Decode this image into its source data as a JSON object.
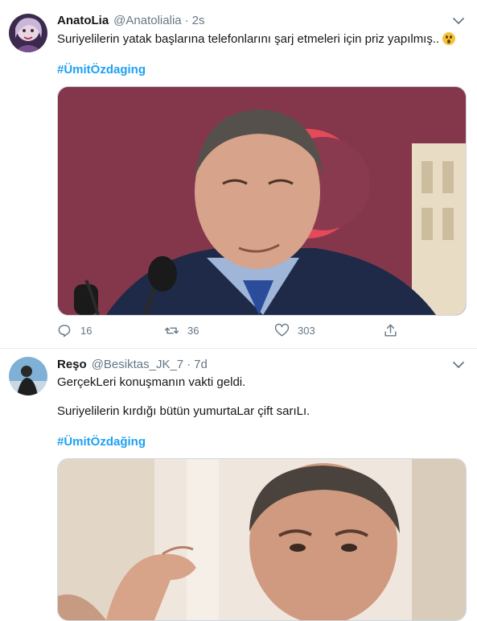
{
  "tweets": [
    {
      "name": "AnatoLia",
      "handle": "@Anatolialia",
      "separator": "·",
      "time": "2s",
      "text": "Suriyelilerin yatak başlarına telefonlarını şarj etmeleri için priz yapılmış..",
      "emoji": "hushed-face-emoji",
      "hashtag": "#ÜmitÖzdaging",
      "actions": {
        "replies": "16",
        "retweets": "36",
        "likes": "303"
      }
    },
    {
      "name": "Reşo",
      "handle": "@Besiktas_JK_7",
      "separator": "·",
      "time": "7d",
      "text_line1": "GerçekLeri konuşmanın vakti geldi.",
      "text_line2": "Suriyelilerin kırdığı bütün yumurtaLar çift sarıLı.",
      "hashtag": "#ÜmitÖzdağing"
    }
  ],
  "icons": {
    "more": "chevron-down-icon",
    "reply": "reply-icon",
    "retweet": "retweet-icon",
    "like": "heart-icon",
    "share": "share-icon"
  },
  "colors": {
    "link": "#1da1f2",
    "secondary_text": "#657786",
    "divider": "#e6ecf0"
  }
}
